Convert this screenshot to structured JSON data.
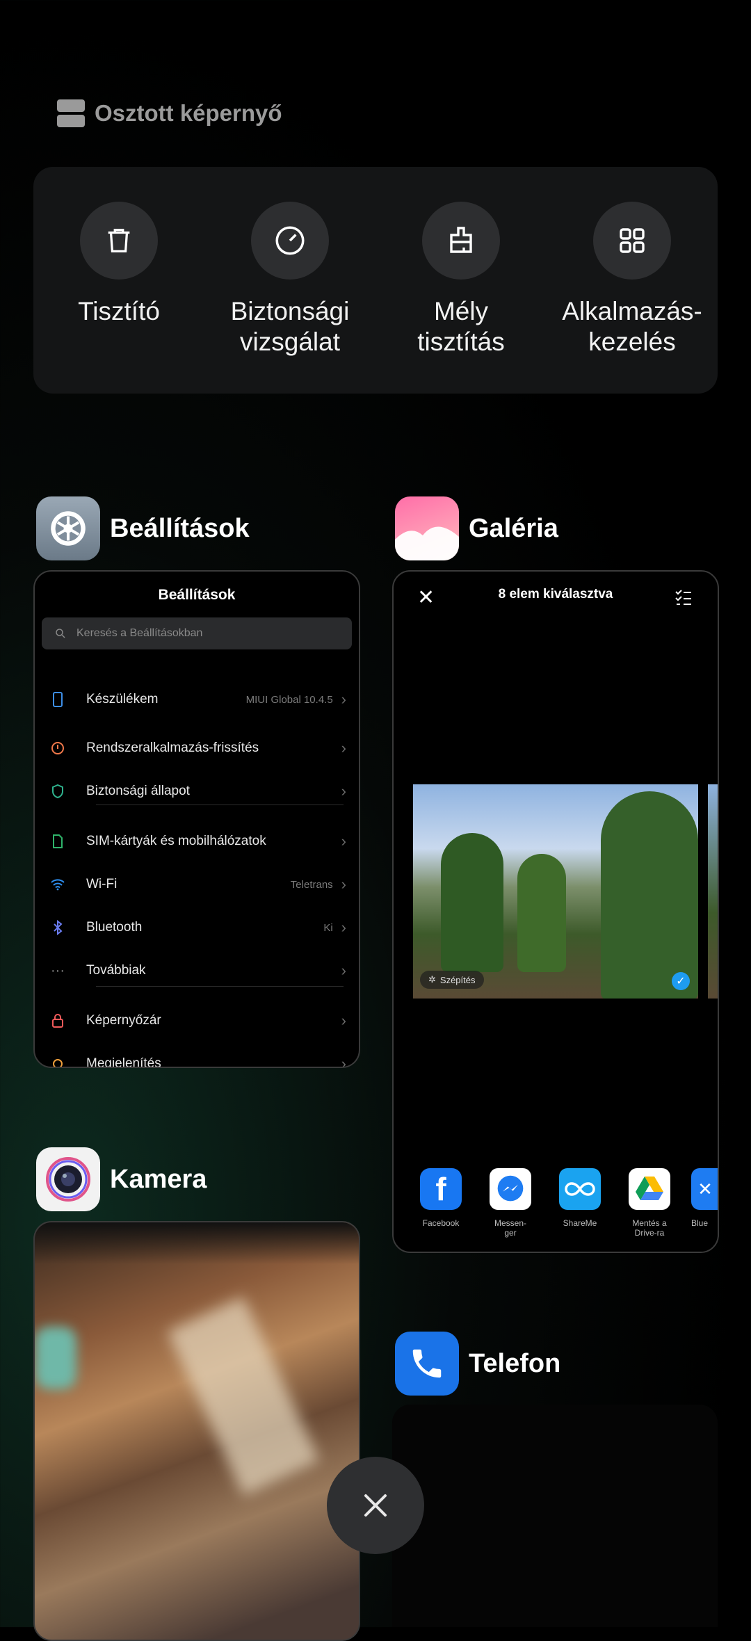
{
  "split_screen": {
    "label": "Osztott képernyő",
    "icon": "split-screen-icon"
  },
  "tools": [
    {
      "label": "Tisztító",
      "icon": "trash-icon"
    },
    {
      "label": "Biztonsági\nvizsgálat",
      "icon": "security-scan-icon"
    },
    {
      "label": "Mély\ntisztítás",
      "icon": "deep-clean-icon"
    },
    {
      "label": "Alkalmazás-\nkezelés",
      "icon": "app-manager-icon"
    }
  ],
  "apps": {
    "settings": {
      "name": "Beállítások"
    },
    "gallery": {
      "name": "Galéria"
    },
    "camera": {
      "name": "Kamera"
    },
    "phone": {
      "name": "Telefon"
    }
  },
  "settings_card": {
    "title": "Beállítások",
    "search_placeholder": "Keresés a Beállításokban",
    "rows": [
      {
        "label": "Készülékem",
        "value": "MIUI Global 10.4.5",
        "icon_color": "#3d8ee6"
      },
      {
        "label": "Rendszeralkalmazás-frissítés",
        "value": "",
        "icon_color": "#f0784a"
      },
      {
        "label": "Biztonsági állapot",
        "value": "",
        "icon_color": "#2fb38e"
      },
      {
        "label": "SIM-kártyák és mobilhálózatok",
        "value": "",
        "icon_color": "#2fb36a"
      },
      {
        "label": "Wi-Fi",
        "value": "Teletrans",
        "icon_color": "#2e8ff0"
      },
      {
        "label": "Bluetooth",
        "value": "Ki",
        "icon_color": "#6a7cf0"
      },
      {
        "label": "Továbbiak",
        "value": "",
        "icon_color": "#8a8a8a"
      },
      {
        "label": "Képernyőzár",
        "value": "",
        "icon_color": "#f05a5a"
      },
      {
        "label": "Megjelenítés",
        "value": "",
        "icon_color": "#f0a03c"
      }
    ]
  },
  "gallery_card": {
    "title": "8 elem kiválasztva",
    "photo_badge": "Szépítés",
    "share": [
      {
        "label": "Facebook",
        "icon": "facebook-icon"
      },
      {
        "label": "Messen-\nger",
        "icon": "messenger-icon"
      },
      {
        "label": "ShareMe",
        "icon": "shareme-icon"
      },
      {
        "label": "Mentés a\nDrive-ra",
        "icon": "google-drive-icon"
      },
      {
        "label": "Blue",
        "icon": "bluetooth-share-icon"
      }
    ]
  }
}
